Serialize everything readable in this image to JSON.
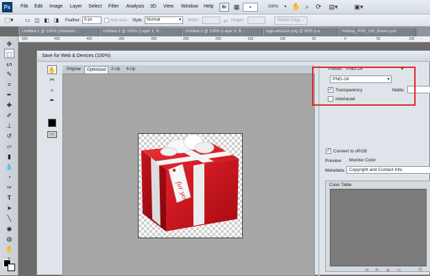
{
  "app": {
    "logo": "Ps"
  },
  "menubar": {
    "items": [
      "File",
      "Edit",
      "Image",
      "Layer",
      "Select",
      "Filter",
      "Analysis",
      "3D",
      "View",
      "Window",
      "Help"
    ],
    "zoom": "100%"
  },
  "options": {
    "feather_label": "Feather:",
    "feather_value": "0 px",
    "antialias_label": "Anti-alias",
    "style_label": "Style:",
    "style_value": "Normal",
    "width_label": "Width:",
    "height_label": "Height:",
    "refine_label": "Refine Edge..."
  },
  "doc_tabs": [
    "Untitled-1 @ 100% (Volumen...",
    "Untitled-2 @ 100% (Layer 1, R...",
    "Untitled-3 @ 100% (Layer 3, R...",
    "logo-amazon.png @ 50% (La...",
    "Holiday_PSD_Gift_Boxes.psd"
  ],
  "ruler": {
    "ticks": [
      "500",
      "450",
      "400",
      "350",
      "300",
      "250",
      "200",
      "150",
      "100",
      "50",
      "0",
      "50",
      "100"
    ]
  },
  "dialog": {
    "title": "Save for Web & Devices (100%)",
    "view_tabs": [
      "Original",
      "Optimized",
      "2-Up",
      "4-Up"
    ],
    "active_tab": "Optimized",
    "preset_label": "Preset:",
    "preset_value": "PNG-24",
    "format_value": "PNG-24",
    "transparency_label": "Transparency",
    "transparency_checked": true,
    "matte_label": "Matte:",
    "interlaced_label": "Interlaced",
    "interlaced_checked": false,
    "convert_label": "Convert to sRGB",
    "convert_checked": true,
    "preview_label": "Preview:",
    "preview_value": "Monitor Color",
    "metadata_label": "Metadata:",
    "metadata_value": "Copyright and Contact Info",
    "color_table_label": "Color Table"
  },
  "image": {
    "tag_text": "for you"
  },
  "colors": {
    "highlight": "#e0262a",
    "box_red": "#d4121c",
    "ribbon": "#e8e8e8"
  }
}
